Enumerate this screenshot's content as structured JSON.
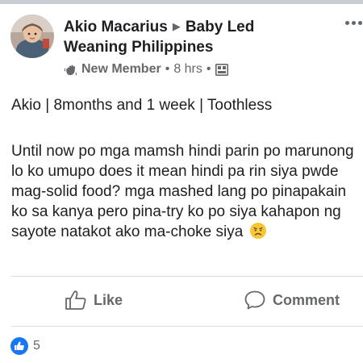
{
  "post": {
    "author": "Akio Macarius",
    "group": "Baby Led Weaning Philippines",
    "group_line1": "Baby Led",
    "group_line2": "Weaning Philippines",
    "badge": "New Member",
    "time": "8 hrs",
    "separator": "•",
    "body_line1": "Akio | 8months and 1 week | Toothless",
    "body_paragraph": "Until now po mga mamsh hindi parin po marunong lo ko umupo does it mean hindi pa rin siya pwde mag-solid food? mga mashed lang po pinapakain ko sa kanya pero pina-try ko po siya kahapon ng sayote natakot ako ma-choke siya",
    "emoji": "disappointed-face"
  },
  "actions": {
    "like_label": "Like",
    "comment_label": "Comment"
  },
  "reactions": {
    "count": "5",
    "icon": "like-reaction-icon"
  },
  "colors": {
    "text": "#1c1e21",
    "secondary": "#65676b",
    "accent": "#1877f2",
    "divider": "#dadde1"
  }
}
